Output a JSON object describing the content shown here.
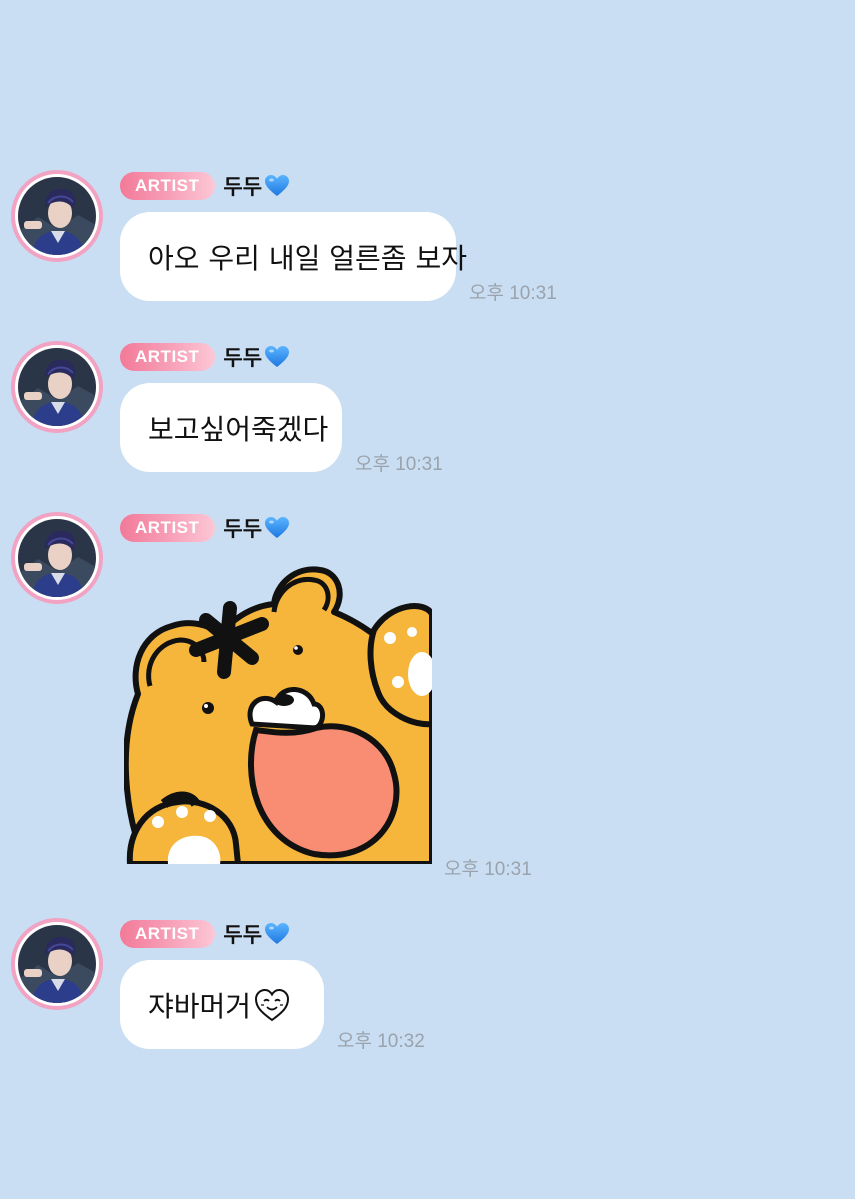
{
  "chat": {
    "messages": [
      {
        "badge": "ARTIST",
        "sender": "두두",
        "text": "아오 우리 내일 얼른좀 보자",
        "time": "오후 10:31"
      },
      {
        "badge": "ARTIST",
        "sender": "두두",
        "text": "보고싶어죽겠다",
        "time": "오후 10:31"
      },
      {
        "badge": "ARTIST",
        "sender": "두두",
        "sticker": "tiger-sticker",
        "time": "오후 10:31"
      },
      {
        "badge": "ARTIST",
        "sender": "두두",
        "text": "쟈바머거",
        "time": "오후 10:32"
      }
    ]
  },
  "icons": {
    "sender_heart": "blue-heart-icon",
    "smile": "smiling-heart-icon"
  },
  "colors": {
    "background": "#c9def2",
    "badge_start": "#f27a98",
    "badge_end": "#fcc7d6",
    "avatar_ring": "#f2a2c2",
    "heart": "#2f8ff0",
    "timestamp": "#9aa3ad"
  }
}
